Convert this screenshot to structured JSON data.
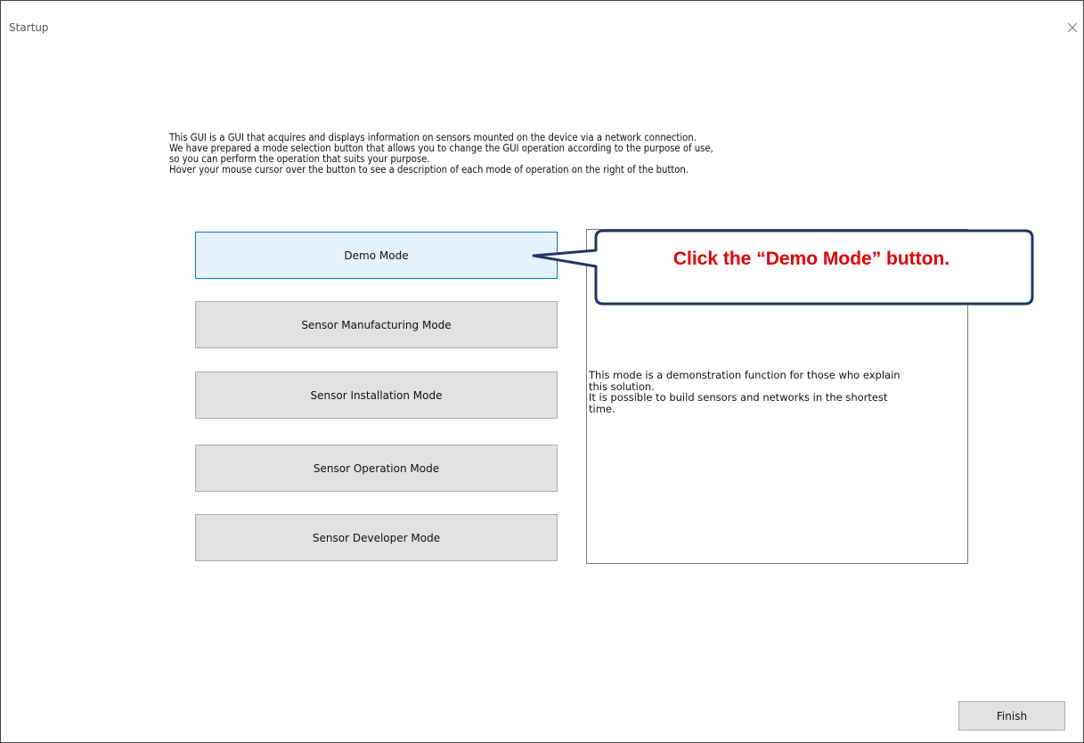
{
  "window": {
    "title": "Startup"
  },
  "intro": {
    "lines": [
      "This GUI is a GUI that acquires and displays information on sensors mounted on the device via a network connection.",
      "We have prepared a mode selection button that allows you to change the GUI operation according to the purpose of use,",
      "so you can perform the operation that suits your purpose.",
      "Hover your mouse cursor over the button to see a description of each mode of operation on the right of the button."
    ]
  },
  "modes": [
    {
      "label": "Demo Mode",
      "state": "hover"
    },
    {
      "label": "Sensor Manufacturing Mode",
      "state": "normal"
    },
    {
      "label": "Sensor Installation Mode",
      "state": "normal"
    },
    {
      "label": "Sensor Operation Mode",
      "state": "normal"
    },
    {
      "label": "Sensor Developer Mode",
      "state": "normal"
    }
  ],
  "description": {
    "lines": [
      "This mode is a demonstration function for those who explain",
      "this solution.",
      "It is possible to build sensors and networks in the shortest",
      "time."
    ]
  },
  "callout": {
    "text": "Click the “Demo Mode” button.",
    "text_color": "#e00000",
    "border_color": "#1f3864"
  },
  "footer": {
    "finish_label": "Finish"
  },
  "icons": {
    "close": "close-icon"
  }
}
